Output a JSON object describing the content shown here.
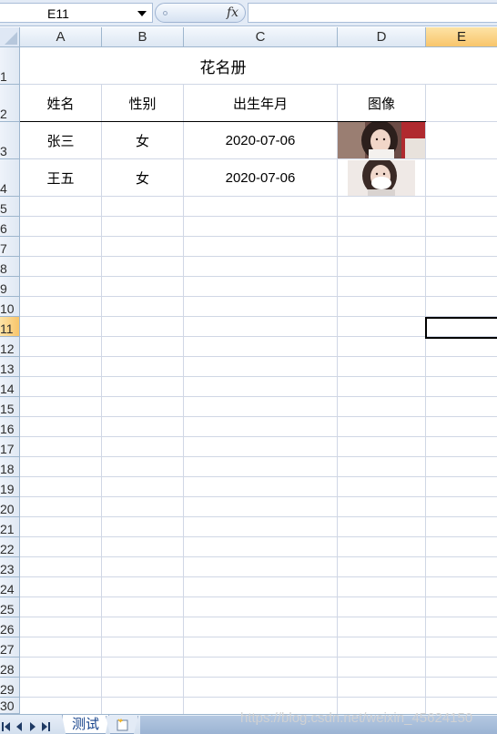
{
  "formula_bar": {
    "name_box": "E11",
    "fx_label": "fx",
    "formula": ""
  },
  "columns": [
    "A",
    "B",
    "C",
    "D",
    "E"
  ],
  "rows": [
    "1",
    "2",
    "3",
    "4",
    "5",
    "6",
    "7",
    "8",
    "9",
    "10",
    "11",
    "12",
    "13",
    "14",
    "15",
    "16",
    "17",
    "18",
    "19",
    "20",
    "21",
    "22",
    "23",
    "24",
    "25",
    "26",
    "27",
    "28",
    "29",
    "30"
  ],
  "selected": {
    "column": "E",
    "row": "11"
  },
  "sheet": {
    "title": "花名册",
    "headers": [
      "姓名",
      "性别",
      "出生年月",
      "图像"
    ],
    "records": [
      {
        "name": "张三",
        "gender": "女",
        "birth": "2020-07-06"
      },
      {
        "name": "王五",
        "gender": "女",
        "birth": "2020-07-06"
      }
    ]
  },
  "tabs": {
    "active": "测试"
  },
  "watermark": "https://blog.csdn.net/weixin_45624150",
  "colors": {
    "selected_header": "#f8c56b",
    "tab_text": "#15428b",
    "gridline": "#d0d7e5"
  }
}
